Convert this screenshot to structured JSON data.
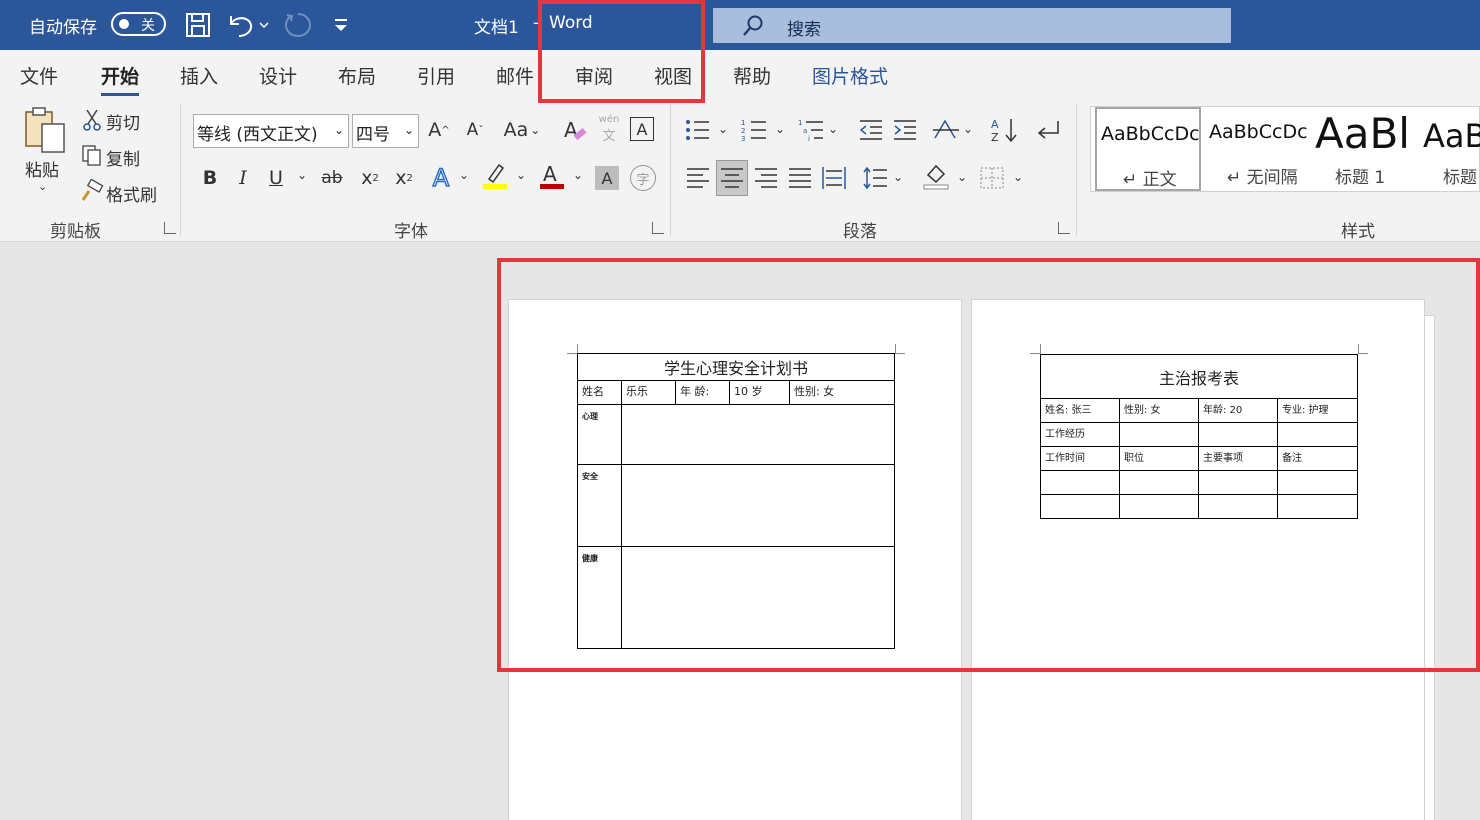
{
  "titlebar": {
    "autosave_label": "自动保存",
    "toggle_label": "关",
    "doc_title": "文档1",
    "separator": "-",
    "app_name": "Word",
    "search_placeholder": "搜索"
  },
  "tabs": [
    "文件",
    "开始",
    "插入",
    "设计",
    "布局",
    "引用",
    "邮件",
    "审阅",
    "视图",
    "帮助",
    "图片格式"
  ],
  "ribbon": {
    "clipboard": {
      "paste": "粘贴",
      "cut": "剪切",
      "copy": "复制",
      "format_painter": "格式刷",
      "label": "剪贴板"
    },
    "font": {
      "font_name": "等线 (西文正文)",
      "font_size": "四号",
      "label": "字体",
      "pinyin_top": "wén",
      "pinyin_bottom": "文",
      "bold": "B",
      "italic": "I",
      "underline": "U",
      "strike": "ab",
      "sub": "x",
      "sup": "x",
      "change_case": "Aa",
      "enclose": "字",
      "font_color_hex": "#c00000",
      "highlight_hex": "#ffff00"
    },
    "paragraph": {
      "label": "段落"
    },
    "styles": {
      "label": "样式",
      "items": [
        {
          "sample": "AaBbCcDc",
          "name": "↵ 正文"
        },
        {
          "sample": "AaBbCcDc",
          "name": "↵ 无间隔"
        },
        {
          "sample": "AaBl",
          "name": "标题 1"
        },
        {
          "sample": "AaB",
          "name": "标题"
        }
      ]
    }
  },
  "page1": {
    "title": "学生心理安全计划书",
    "row1": [
      "姓名",
      "乐乐",
      "年 龄:",
      "10 岁",
      "性别: 女"
    ],
    "sections": [
      "心理",
      "安全",
      "健康"
    ]
  },
  "page2": {
    "title": "主治报考表",
    "row1": [
      "姓名: 张三",
      "性别: 女",
      "年龄: 20",
      "专业: 护理"
    ],
    "row2_label": "工作经历",
    "row3": [
      "工作时间",
      "职位",
      "主要事项",
      "备注"
    ]
  },
  "colors": {
    "brand": "#2b579a",
    "highlight_box": "#e4363d"
  }
}
